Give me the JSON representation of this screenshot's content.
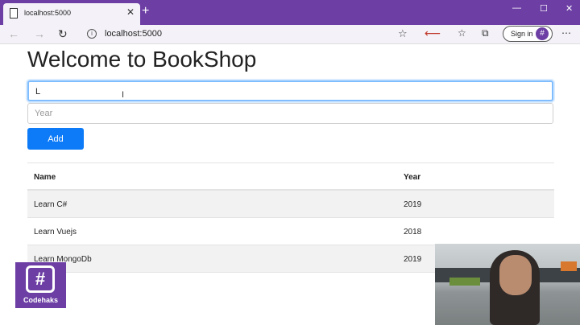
{
  "browser": {
    "tab_title": "localhost:5000",
    "tab_close": "✕",
    "new_tab": "+",
    "window_minimize": "—",
    "window_maximize": "☐",
    "window_close": "✕",
    "address": "localhost:5000",
    "sign_in_label": "Sign in",
    "avatar_glyph": "#"
  },
  "page": {
    "title": "Welcome to BookShop",
    "name_input_value": "L",
    "year_placeholder": "Year",
    "add_button_label": "Add"
  },
  "table": {
    "headers": [
      "Name",
      "Year"
    ],
    "rows": [
      {
        "name": "Learn C#",
        "year": "2019"
      },
      {
        "name": "Learn Vuejs",
        "year": "2018"
      },
      {
        "name": "Learn MongoDb",
        "year": "2019"
      }
    ]
  },
  "overlay": {
    "logo_glyph": "#",
    "logo_text": "Codehaks"
  }
}
